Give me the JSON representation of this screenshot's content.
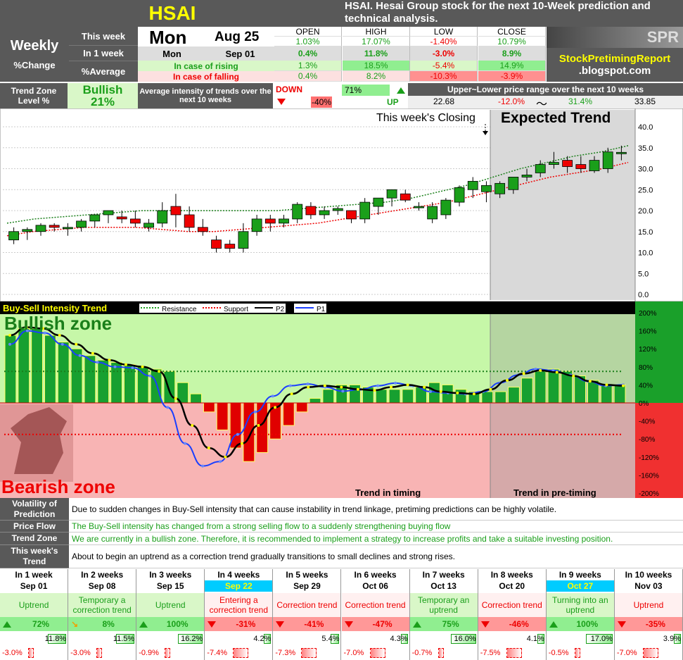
{
  "header": {
    "ticker": "HSAI",
    "desc": "HSAI. Hesai Group stock for the next 10-Week prediction and technical analysis.",
    "weekly": "Weekly",
    "pct_change": "%Change",
    "this_week": "This week",
    "in_1_week": "In 1 week",
    "pct_average": "%Average",
    "day": "Mon",
    "date": "Aug 25",
    "next_day": "Mon",
    "next_date": "Sep 01",
    "cols": [
      "OPEN",
      "HIGH",
      "LOW",
      "CLOSE"
    ],
    "row_this": [
      "1.03%",
      "17.07%",
      "-1.40%",
      "10.79%"
    ],
    "row_1w": [
      "0.4%",
      "11.8%",
      "-3.0%",
      "8.9%"
    ],
    "rising_label": "In case of rising",
    "row_rising": [
      "1.3%",
      "18.5%",
      "-5.4%",
      "14.9%"
    ],
    "falling_label": "In case of falling",
    "row_falling": [
      "0.4%",
      "8.2%",
      "-10.3%",
      "-3.9%"
    ],
    "spr": "SPR",
    "site1": "StockPretimingReport",
    "site2": ".blogspot.com"
  },
  "trend": {
    "zone_label": "Trend Zone",
    "level_label": "Level %",
    "zone": "Bullish",
    "level": "21%",
    "avg_label": "Average intensity of trends over the next 10 weeks",
    "down": "DOWN",
    "down_val": "-40%",
    "up": "UP",
    "up_val": "71%",
    "range_label": "Upper~Lower price range over the next 10 weeks",
    "low": "22.68",
    "low_pct": "-12.0%",
    "tilde": "〜",
    "high_pct": "31.4%",
    "high": "33.85"
  },
  "chart_labels": {
    "closing": "This week's Closing",
    "expected": "Expected Trend",
    "yticks": [
      "40.0",
      "35.0",
      "30.0",
      "25.0",
      "20.0",
      "15.0",
      "10.0",
      "5.0",
      "0.0"
    ]
  },
  "chart_data": [
    {
      "type": "candlestick",
      "candles": [
        [
          13,
          16,
          12,
          15
        ],
        [
          15,
          16,
          13,
          15.5
        ],
        [
          15,
          17,
          14,
          16.5
        ],
        [
          16.5,
          17,
          15,
          16
        ],
        [
          16,
          17,
          14,
          16
        ],
        [
          16,
          18,
          15,
          17.5
        ],
        [
          17.5,
          19,
          16,
          19
        ],
        [
          19,
          20,
          17,
          20
        ],
        [
          18.5,
          20,
          17,
          18
        ],
        [
          18,
          20,
          16,
          17
        ],
        [
          16,
          18,
          15,
          17
        ],
        [
          17,
          22,
          16,
          20
        ],
        [
          21,
          24,
          16,
          19
        ],
        [
          19,
          21,
          15,
          16
        ],
        [
          16,
          18,
          14,
          15
        ],
        [
          13,
          14,
          10,
          11
        ],
        [
          12,
          13,
          10,
          11
        ],
        [
          11,
          17,
          10,
          15
        ],
        [
          15,
          19,
          14,
          18
        ],
        [
          18,
          19,
          15,
          17
        ],
        [
          17,
          19,
          16,
          18
        ],
        [
          18,
          22,
          17,
          21.5
        ],
        [
          21,
          22,
          18,
          19
        ],
        [
          19,
          21,
          18,
          20
        ],
        [
          20,
          21,
          19,
          20.5
        ],
        [
          20,
          20,
          17,
          18
        ],
        [
          18,
          23,
          17,
          22
        ],
        [
          21,
          23,
          19,
          23
        ],
        [
          23,
          25,
          21,
          25
        ],
        [
          24,
          25,
          22,
          22.5
        ],
        [
          21,
          22,
          20,
          21
        ],
        [
          18,
          22,
          17,
          21
        ],
        [
          19,
          23,
          18,
          22.5
        ],
        [
          22,
          26,
          21,
          25.5
        ],
        [
          25,
          28,
          23,
          27
        ],
        [
          24.5,
          27,
          22,
          26
        ],
        [
          24,
          27,
          23,
          26.5
        ],
        [
          25,
          28,
          24,
          28
        ],
        [
          28,
          30,
          27,
          28.5
        ],
        [
          29,
          32,
          28,
          31
        ],
        [
          31,
          34,
          30,
          31.5
        ],
        [
          32,
          33,
          29,
          30.5
        ],
        [
          31,
          33,
          29,
          30
        ],
        [
          29.5,
          33,
          29,
          32
        ],
        [
          30,
          35,
          29,
          34
        ],
        [
          33.9,
          35.5,
          32,
          33.9
        ]
      ],
      "resistance": [
        17,
        18,
        18.5,
        19,
        19.5,
        20,
        20,
        20,
        20,
        20,
        20,
        20.5,
        21,
        21.5,
        22,
        23,
        24.5,
        26,
        28,
        30,
        31.5,
        33,
        34,
        35.5
      ],
      "support": [
        14,
        15,
        15.5,
        16,
        16,
        16,
        15.5,
        15,
        15,
        15.5,
        16,
        16.5,
        17,
        18,
        19,
        20,
        21,
        22,
        23.5,
        25,
        26.5,
        28,
        29,
        30,
        31.5
      ],
      "ylim": [
        0,
        40
      ],
      "yticks": [
        0,
        5,
        10,
        15,
        20,
        25,
        30,
        35,
        40
      ],
      "future_weeks": 10
    },
    {
      "type": "bar",
      "title": "Buy-Sell Intensity Trend",
      "series": [
        {
          "name": "Resistance"
        },
        {
          "name": "Support"
        },
        {
          "name": "P2"
        },
        {
          "name": "P1"
        }
      ],
      "bars": [
        150,
        165,
        165,
        150,
        135,
        120,
        105,
        95,
        90,
        85,
        80,
        75,
        70,
        45,
        20,
        -20,
        -60,
        -100,
        -130,
        -110,
        -80,
        -50,
        -20,
        10,
        30,
        40,
        40,
        35,
        30,
        30,
        30,
        35,
        45,
        40,
        30,
        25,
        25,
        25,
        35,
        55,
        70,
        75,
        70,
        60,
        50,
        40,
        40
      ],
      "bar_fill": [
        "#17a030",
        "#e00000"
      ],
      "p2": [
        150,
        168,
        165,
        150,
        130,
        110,
        95,
        85,
        80,
        70,
        10,
        -50,
        -100,
        -120,
        -90,
        -50,
        -10,
        20,
        35,
        38,
        35,
        30,
        28,
        35,
        40,
        35,
        25,
        22,
        20,
        30,
        50,
        65,
        72,
        68,
        60,
        48,
        40,
        38
      ],
      "p1": [
        130,
        160,
        155,
        130,
        105,
        90,
        80,
        78,
        60,
        -10,
        -90,
        -140,
        -130,
        -70,
        -20,
        15,
        38,
        42,
        35,
        26,
        30,
        38,
        44,
        38,
        25,
        22,
        20,
        25,
        45,
        62,
        75,
        72,
        62,
        48,
        38,
        40
      ],
      "ylim": [
        -200,
        200
      ],
      "yticks_labels": [
        "200%",
        "160%",
        "120%",
        "80%",
        "40%",
        "0%",
        "-40%",
        "-80%",
        "-120%",
        "-160%",
        "-200%"
      ],
      "bullish_label": "Bullish zone",
      "bearish_label": "Bearish zone",
      "timing": "Trend in timing",
      "pretiming": "Trend in pre-timing"
    }
  ],
  "analysis": [
    {
      "label": "Volatility of Prediction",
      "text": "Due to sudden changes in Buy-Sell intensity that can cause instability in trend linkage, pretiming predictions can be highly volatile."
    },
    {
      "label": "Price Flow",
      "text": "The Buy-Sell intensity has changed from a strong selling flow to a suddenly strengthening buying flow"
    },
    {
      "label": "Trend Zone",
      "text": "We are currently in a bullish zone. Therefore, it is recommended to implement a strategy to increase profits and take a suitable investing position."
    },
    {
      "label": "This week's Trend",
      "text": "About to begin an uptrend as a correction trend gradually transitions to small declines and strong rises."
    }
  ],
  "weeks": [
    {
      "w": "In 1 week",
      "d": "Sep 01",
      "trend": "Uptrend",
      "dir": "up",
      "pct": "72%",
      "high": "11.8%",
      "low": "-3.0%",
      "hl": 0,
      "fill": 0.55
    },
    {
      "w": "In 2 weeks",
      "d": "Sep 08",
      "trend": "Temporary a correction trend",
      "dir": "diag",
      "pct": "8%",
      "high": "11.5%",
      "low": "-3.0%",
      "hl": 0,
      "fill": 0.55
    },
    {
      "w": "In 3 weeks",
      "d": "Sep 15",
      "trend": "Uptrend",
      "dir": "up",
      "pct": "100%",
      "high": "16.2%",
      "low": "-0.9%",
      "hl": 0,
      "fill": 0.75
    },
    {
      "w": "In 4 weeks",
      "d": "Sep 22",
      "trend": "Entering a correction trend",
      "dir": "down",
      "pct": "-31%",
      "high": "4.2%",
      "low": "-7.4%",
      "hl": 1,
      "fill": 0.2
    },
    {
      "w": "In 5 weeks",
      "d": "Sep 29",
      "trend": "Correction trend",
      "dir": "down",
      "pct": "-41%",
      "high": "5.4%",
      "low": "-7.3%",
      "hl": 0,
      "fill": 0.25
    },
    {
      "w": "In 6 weeks",
      "d": "Oct 06",
      "trend": "Correction trend",
      "dir": "down",
      "pct": "-47%",
      "high": "4.3%",
      "low": "-7.0%",
      "hl": 0,
      "fill": 0.2
    },
    {
      "w": "In 7 weeks",
      "d": "Oct 13",
      "trend": "Temporary an uptrend",
      "dir": "up",
      "pct": "75%",
      "high": "16.0%",
      "low": "-0.7%",
      "hl": 0,
      "fill": 0.75
    },
    {
      "w": "In 8 weeks",
      "d": "Oct 20",
      "trend": "Correction trend",
      "dir": "down",
      "pct": "-46%",
      "high": "4.1%",
      "low": "-7.5%",
      "hl": 0,
      "fill": 0.2
    },
    {
      "w": "In 9 weeks",
      "d": "Oct 27",
      "trend": "Turning into an uptrend",
      "dir": "up",
      "pct": "100%",
      "high": "17.0%",
      "low": "-0.5%",
      "hl": 1,
      "fill": 0.8
    },
    {
      "w": "In 10 weeks",
      "d": "Nov 03",
      "trend": "Uptrend",
      "dir": "down",
      "pct": "-35%",
      "high": "3.9%",
      "low": "-7.0%",
      "hl": 0,
      "fill": 0.2
    }
  ]
}
